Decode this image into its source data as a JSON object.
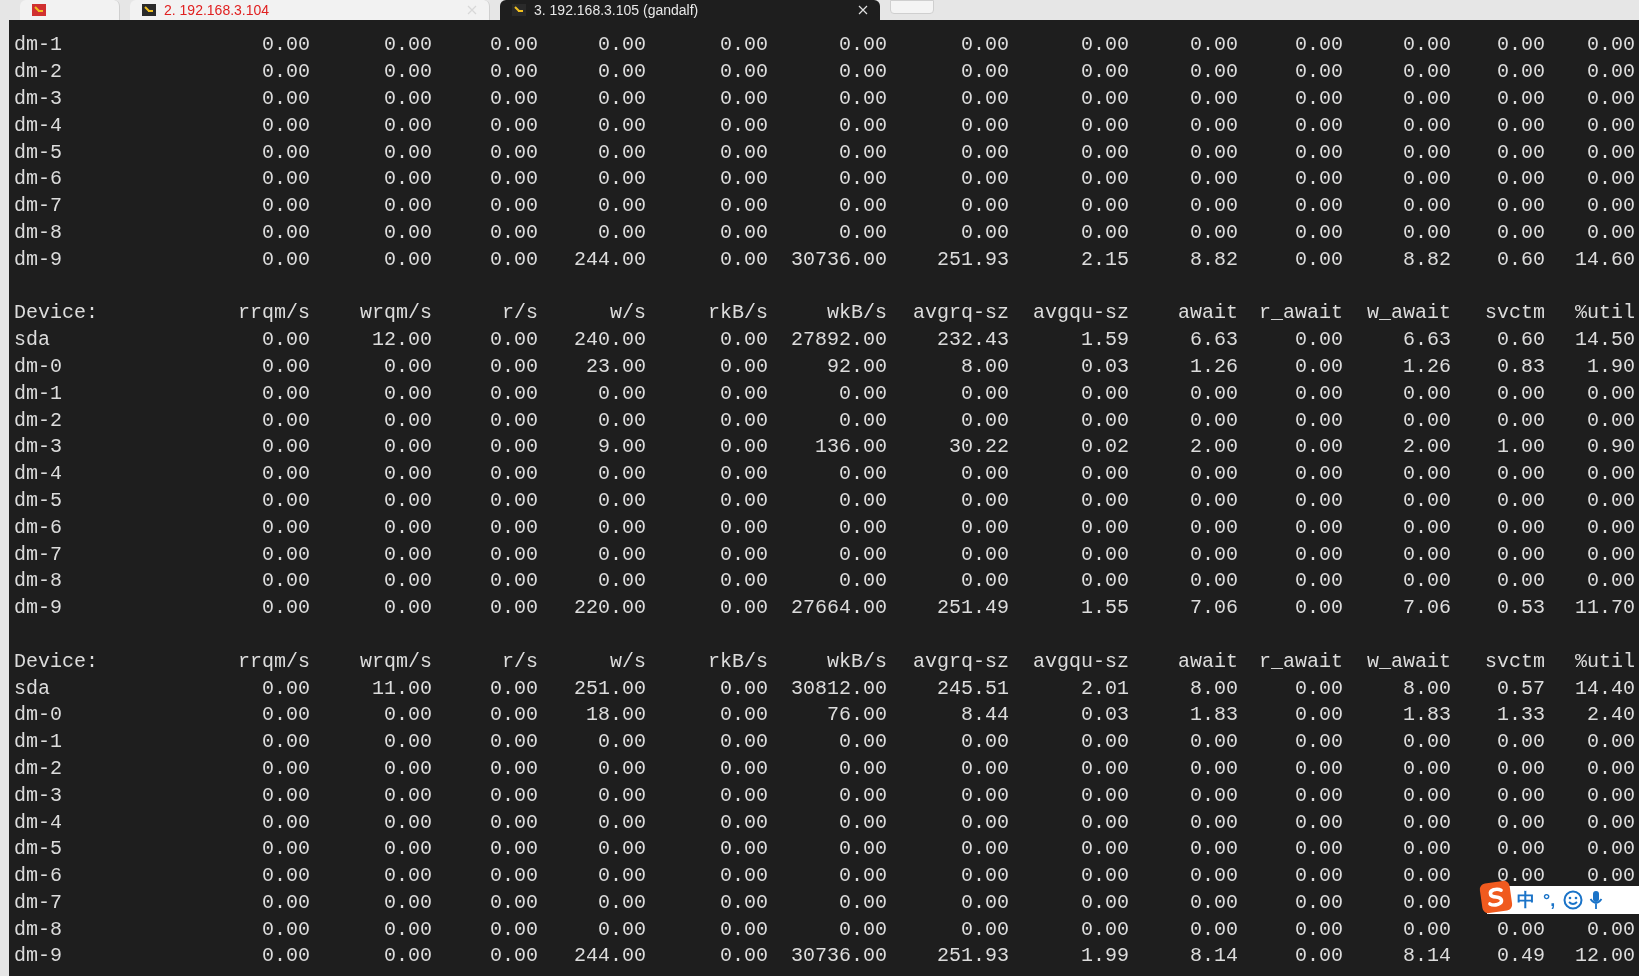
{
  "tabs": [
    {
      "selected": false
    },
    {
      "label": "2. 192.168.3.104",
      "selected": false,
      "color": "#e02020"
    },
    {
      "label": "3. 192.168.3.105 (gandalf)",
      "selected": true,
      "color": "#e8e8e8"
    }
  ],
  "terminal": {
    "blocks": [
      {
        "rows": [
          [
            "dm-1",
            "0.00",
            "0.00",
            "0.00",
            "0.00",
            "0.00",
            "0.00",
            "0.00",
            "0.00",
            "0.00",
            "0.00",
            "0.00",
            "0.00",
            "0.00"
          ],
          [
            "dm-2",
            "0.00",
            "0.00",
            "0.00",
            "0.00",
            "0.00",
            "0.00",
            "0.00",
            "0.00",
            "0.00",
            "0.00",
            "0.00",
            "0.00",
            "0.00"
          ],
          [
            "dm-3",
            "0.00",
            "0.00",
            "0.00",
            "0.00",
            "0.00",
            "0.00",
            "0.00",
            "0.00",
            "0.00",
            "0.00",
            "0.00",
            "0.00",
            "0.00"
          ],
          [
            "dm-4",
            "0.00",
            "0.00",
            "0.00",
            "0.00",
            "0.00",
            "0.00",
            "0.00",
            "0.00",
            "0.00",
            "0.00",
            "0.00",
            "0.00",
            "0.00"
          ],
          [
            "dm-5",
            "0.00",
            "0.00",
            "0.00",
            "0.00",
            "0.00",
            "0.00",
            "0.00",
            "0.00",
            "0.00",
            "0.00",
            "0.00",
            "0.00",
            "0.00"
          ],
          [
            "dm-6",
            "0.00",
            "0.00",
            "0.00",
            "0.00",
            "0.00",
            "0.00",
            "0.00",
            "0.00",
            "0.00",
            "0.00",
            "0.00",
            "0.00",
            "0.00"
          ],
          [
            "dm-7",
            "0.00",
            "0.00",
            "0.00",
            "0.00",
            "0.00",
            "0.00",
            "0.00",
            "0.00",
            "0.00",
            "0.00",
            "0.00",
            "0.00",
            "0.00"
          ],
          [
            "dm-8",
            "0.00",
            "0.00",
            "0.00",
            "0.00",
            "0.00",
            "0.00",
            "0.00",
            "0.00",
            "0.00",
            "0.00",
            "0.00",
            "0.00",
            "0.00"
          ],
          [
            "dm-9",
            "0.00",
            "0.00",
            "0.00",
            "244.00",
            "0.00",
            "30736.00",
            "251.93",
            "2.15",
            "8.82",
            "0.00",
            "8.82",
            "0.60",
            "14.60"
          ]
        ]
      },
      {
        "header": [
          "Device:",
          "rrqm/s",
          "wrqm/s",
          "r/s",
          "w/s",
          "rkB/s",
          "wkB/s",
          "avgrq-sz",
          "avgqu-sz",
          "await",
          "r_await",
          "w_await",
          "svctm",
          "%util"
        ],
        "rows": [
          [
            "sda",
            "0.00",
            "12.00",
            "0.00",
            "240.00",
            "0.00",
            "27892.00",
            "232.43",
            "1.59",
            "6.63",
            "0.00",
            "6.63",
            "0.60",
            "14.50"
          ],
          [
            "dm-0",
            "0.00",
            "0.00",
            "0.00",
            "23.00",
            "0.00",
            "92.00",
            "8.00",
            "0.03",
            "1.26",
            "0.00",
            "1.26",
            "0.83",
            "1.90"
          ],
          [
            "dm-1",
            "0.00",
            "0.00",
            "0.00",
            "0.00",
            "0.00",
            "0.00",
            "0.00",
            "0.00",
            "0.00",
            "0.00",
            "0.00",
            "0.00",
            "0.00"
          ],
          [
            "dm-2",
            "0.00",
            "0.00",
            "0.00",
            "0.00",
            "0.00",
            "0.00",
            "0.00",
            "0.00",
            "0.00",
            "0.00",
            "0.00",
            "0.00",
            "0.00"
          ],
          [
            "dm-3",
            "0.00",
            "0.00",
            "0.00",
            "9.00",
            "0.00",
            "136.00",
            "30.22",
            "0.02",
            "2.00",
            "0.00",
            "2.00",
            "1.00",
            "0.90"
          ],
          [
            "dm-4",
            "0.00",
            "0.00",
            "0.00",
            "0.00",
            "0.00",
            "0.00",
            "0.00",
            "0.00",
            "0.00",
            "0.00",
            "0.00",
            "0.00",
            "0.00"
          ],
          [
            "dm-5",
            "0.00",
            "0.00",
            "0.00",
            "0.00",
            "0.00",
            "0.00",
            "0.00",
            "0.00",
            "0.00",
            "0.00",
            "0.00",
            "0.00",
            "0.00"
          ],
          [
            "dm-6",
            "0.00",
            "0.00",
            "0.00",
            "0.00",
            "0.00",
            "0.00",
            "0.00",
            "0.00",
            "0.00",
            "0.00",
            "0.00",
            "0.00",
            "0.00"
          ],
          [
            "dm-7",
            "0.00",
            "0.00",
            "0.00",
            "0.00",
            "0.00",
            "0.00",
            "0.00",
            "0.00",
            "0.00",
            "0.00",
            "0.00",
            "0.00",
            "0.00"
          ],
          [
            "dm-8",
            "0.00",
            "0.00",
            "0.00",
            "0.00",
            "0.00",
            "0.00",
            "0.00",
            "0.00",
            "0.00",
            "0.00",
            "0.00",
            "0.00",
            "0.00"
          ],
          [
            "dm-9",
            "0.00",
            "0.00",
            "0.00",
            "220.00",
            "0.00",
            "27664.00",
            "251.49",
            "1.55",
            "7.06",
            "0.00",
            "7.06",
            "0.53",
            "11.70"
          ]
        ]
      },
      {
        "header": [
          "Device:",
          "rrqm/s",
          "wrqm/s",
          "r/s",
          "w/s",
          "rkB/s",
          "wkB/s",
          "avgrq-sz",
          "avgqu-sz",
          "await",
          "r_await",
          "w_await",
          "svctm",
          "%util"
        ],
        "rows": [
          [
            "sda",
            "0.00",
            "11.00",
            "0.00",
            "251.00",
            "0.00",
            "30812.00",
            "245.51",
            "2.01",
            "8.00",
            "0.00",
            "8.00",
            "0.57",
            "14.40"
          ],
          [
            "dm-0",
            "0.00",
            "0.00",
            "0.00",
            "18.00",
            "0.00",
            "76.00",
            "8.44",
            "0.03",
            "1.83",
            "0.00",
            "1.83",
            "1.33",
            "2.40"
          ],
          [
            "dm-1",
            "0.00",
            "0.00",
            "0.00",
            "0.00",
            "0.00",
            "0.00",
            "0.00",
            "0.00",
            "0.00",
            "0.00",
            "0.00",
            "0.00",
            "0.00"
          ],
          [
            "dm-2",
            "0.00",
            "0.00",
            "0.00",
            "0.00",
            "0.00",
            "0.00",
            "0.00",
            "0.00",
            "0.00",
            "0.00",
            "0.00",
            "0.00",
            "0.00"
          ],
          [
            "dm-3",
            "0.00",
            "0.00",
            "0.00",
            "0.00",
            "0.00",
            "0.00",
            "0.00",
            "0.00",
            "0.00",
            "0.00",
            "0.00",
            "0.00",
            "0.00"
          ],
          [
            "dm-4",
            "0.00",
            "0.00",
            "0.00",
            "0.00",
            "0.00",
            "0.00",
            "0.00",
            "0.00",
            "0.00",
            "0.00",
            "0.00",
            "0.00",
            "0.00"
          ],
          [
            "dm-5",
            "0.00",
            "0.00",
            "0.00",
            "0.00",
            "0.00",
            "0.00",
            "0.00",
            "0.00",
            "0.00",
            "0.00",
            "0.00",
            "0.00",
            "0.00"
          ],
          [
            "dm-6",
            "0.00",
            "0.00",
            "0.00",
            "0.00",
            "0.00",
            "0.00",
            "0.00",
            "0.00",
            "0.00",
            "0.00",
            "0.00",
            "0.00",
            "0.00"
          ],
          [
            "dm-7",
            "0.00",
            "0.00",
            "0.00",
            "0.00",
            "0.00",
            "0.00",
            "0.00",
            "0.00",
            "0.00",
            "0.00",
            "0.00"
          ],
          [
            "dm-8",
            "0.00",
            "0.00",
            "0.00",
            "0.00",
            "0.00",
            "0.00",
            "0.00",
            "0.00",
            "0.00",
            "0.00",
            "0.00",
            "0.00",
            "0.00"
          ],
          [
            "dm-9",
            "0.00",
            "0.00",
            "0.00",
            "244.00",
            "0.00",
            "30736.00",
            "251.93",
            "1.99",
            "8.14",
            "0.00",
            "8.14",
            "0.49",
            "12.00"
          ]
        ]
      }
    ]
  },
  "ime_bar": {
    "mode": "中",
    "punctuation": "°,"
  }
}
